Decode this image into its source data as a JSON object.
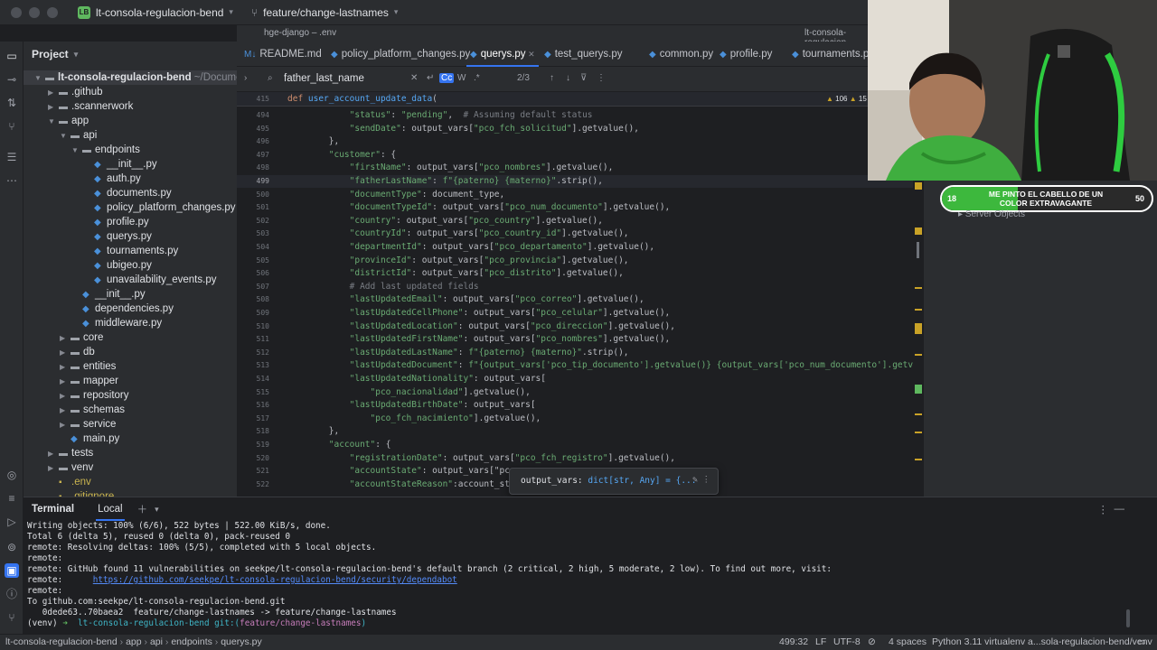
{
  "titlebar": {
    "project_initials": "LB",
    "project_name": "lt-consola-regulacion-bend",
    "branch": "feature/change-lastnames"
  },
  "top_tabs": {
    "left": "hge-django – .env",
    "right": "lt-consola-regulacion"
  },
  "project_panel": {
    "title": "Project",
    "root": "lt-consola-regulacion-bend",
    "root_path": "~/Documents/proje",
    "items": [
      {
        "label": ".github",
        "type": "folder",
        "depth": 1,
        "expanded": false
      },
      {
        "label": ".scannerwork",
        "type": "folder",
        "depth": 1,
        "expanded": false
      },
      {
        "label": "app",
        "type": "folder",
        "depth": 1,
        "expanded": true
      },
      {
        "label": "api",
        "type": "folder",
        "depth": 2,
        "expanded": true
      },
      {
        "label": "endpoints",
        "type": "folder",
        "depth": 3,
        "expanded": true
      },
      {
        "label": "__init__.py",
        "type": "py",
        "depth": 4
      },
      {
        "label": "auth.py",
        "type": "py",
        "depth": 4
      },
      {
        "label": "documents.py",
        "type": "py",
        "depth": 4
      },
      {
        "label": "policy_platform_changes.py",
        "type": "py",
        "depth": 4
      },
      {
        "label": "profile.py",
        "type": "py",
        "depth": 4
      },
      {
        "label": "querys.py",
        "type": "py",
        "depth": 4
      },
      {
        "label": "tournaments.py",
        "type": "py",
        "depth": 4
      },
      {
        "label": "ubigeo.py",
        "type": "py",
        "depth": 4
      },
      {
        "label": "unavailability_events.py",
        "type": "py",
        "depth": 4
      },
      {
        "label": "__init__.py",
        "type": "py",
        "depth": 3
      },
      {
        "label": "dependencies.py",
        "type": "py",
        "depth": 3
      },
      {
        "label": "middleware.py",
        "type": "py",
        "depth": 3
      },
      {
        "label": "core",
        "type": "folder",
        "depth": 2,
        "expanded": false
      },
      {
        "label": "db",
        "type": "folder",
        "depth": 2,
        "expanded": false
      },
      {
        "label": "entities",
        "type": "folder",
        "depth": 2,
        "expanded": false
      },
      {
        "label": "mapper",
        "type": "folder",
        "depth": 2,
        "expanded": false
      },
      {
        "label": "repository",
        "type": "folder",
        "depth": 2,
        "expanded": false
      },
      {
        "label": "schemas",
        "type": "folder",
        "depth": 2,
        "expanded": false
      },
      {
        "label": "service",
        "type": "folder",
        "depth": 2,
        "expanded": false
      },
      {
        "label": "main.py",
        "type": "py",
        "depth": 2
      },
      {
        "label": "tests",
        "type": "folder",
        "depth": 1,
        "expanded": false
      },
      {
        "label": "venv",
        "type": "folder",
        "depth": 1,
        "expanded": false
      },
      {
        "label": ".env",
        "type": "env",
        "depth": 1
      },
      {
        "label": ".gitignore",
        "type": "env",
        "depth": 1
      }
    ]
  },
  "editor_tabs": [
    {
      "label": "README.md",
      "prefix": "M↓",
      "active": false
    },
    {
      "label": "policy_platform_changes.py",
      "active": false
    },
    {
      "label": "querys.py",
      "active": true
    },
    {
      "label": "test_querys.py",
      "active": false
    },
    {
      "label": "common.py",
      "active": false
    },
    {
      "label": "profile.py",
      "active": false
    },
    {
      "label": "tournaments.py",
      "active": false
    }
  ],
  "search": {
    "value": "father_last_name",
    "match_case": "Cc",
    "words": "W",
    "regex": ".*",
    "result": "2/3"
  },
  "editor": {
    "sticky_line": "415",
    "sticky_text": "def user_account_update_data(",
    "warnings": "106",
    "weak_warnings": "15",
    "current_line": "499",
    "lines": [
      {
        "n": "494",
        "code": "            \"status\": \"pending\",  # Assuming default status"
      },
      {
        "n": "495",
        "code": "            \"sendDate\": output_vars[\"pco_fch_solicitud\"].getvalue(),"
      },
      {
        "n": "496",
        "code": "        },"
      },
      {
        "n": "497",
        "code": "        \"customer\": {"
      },
      {
        "n": "498",
        "code": "            \"firstName\": output_vars[\"pco_nombres\"].getvalue(),"
      },
      {
        "n": "499",
        "code": "            \"fatherLastName\": f\"{paterno} {materno}\".strip(),"
      },
      {
        "n": "500",
        "code": "            \"documentType\": document_type,"
      },
      {
        "n": "501",
        "code": "            \"documentTypeId\": output_vars[\"pco_num_documento\"].getvalue(),"
      },
      {
        "n": "502",
        "code": "            \"country\": output_vars[\"pco_country\"].getvalue(),"
      },
      {
        "n": "503",
        "code": "            \"countryId\": output_vars[\"pco_country_id\"].getvalue(),"
      },
      {
        "n": "504",
        "code": "            \"departmentId\": output_vars[\"pco_departamento\"].getvalue(),"
      },
      {
        "n": "505",
        "code": "            \"provinceId\": output_vars[\"pco_provincia\"].getvalue(),"
      },
      {
        "n": "506",
        "code": "            \"districtId\": output_vars[\"pco_distrito\"].getvalue(),"
      },
      {
        "n": "507",
        "code": "            # Add last updated fields"
      },
      {
        "n": "508",
        "code": "            \"lastUpdatedEmail\": output_vars[\"pco_correo\"].getvalue(),"
      },
      {
        "n": "509",
        "code": "            \"lastUpdatedCellPhone\": output_vars[\"pco_celular\"].getvalue(),"
      },
      {
        "n": "510",
        "code": "            \"lastUpdatedLocation\": output_vars[\"pco_direccion\"].getvalue(),"
      },
      {
        "n": "511",
        "code": "            \"lastUpdatedFirstName\": output_vars[\"pco_nombres\"].getvalue(),"
      },
      {
        "n": "512",
        "code": "            \"lastUpdatedLastName\": f\"{paterno} {materno}\".strip(),"
      },
      {
        "n": "513",
        "code": "            \"lastUpdatedDocument\": f\"{output_vars['pco_tip_documento'].getvalue()} {output_vars['pco_num_documento'].getvalue()}\","
      },
      {
        "n": "514",
        "code": "            \"lastUpdatedNationality\": output_vars["
      },
      {
        "n": "515",
        "code": "                \"pco_nacionalidad\"].getvalue(),"
      },
      {
        "n": "516",
        "code": "            \"lastUpdatedBirthDate\": output_vars["
      },
      {
        "n": "517",
        "code": "                \"pco_fch_nacimiento\"].getvalue(),"
      },
      {
        "n": "518",
        "code": "        },"
      },
      {
        "n": "519",
        "code": "        \"account\": {"
      },
      {
        "n": "520",
        "code": "            \"registrationDate\": output_vars[\"pco_fch_registro\"].getvalue(),"
      },
      {
        "n": "521",
        "code": "            \"accountState\": output_vars[\"pc"
      },
      {
        "n": "522",
        "code": "            \"accountStateReason\":account_st"
      }
    ]
  },
  "tooltip": {
    "name": "output_vars",
    "type": "dict[str, Any] = {...",
    "edit_icon": "✎",
    "more_icon": "⋮"
  },
  "overlay": {
    "goal_text": "ME PINTO EL CABELLO DE UN COLOR EXTRAVAGANTE",
    "goal_current": "18",
    "goal_target": "50",
    "goal_fraction": 0.36,
    "server_objects": "Server Objects"
  },
  "terminal": {
    "title": "Terminal",
    "tab": "Local",
    "lines": [
      "Writing objects: 100% (6/6), 522 bytes | 522.00 KiB/s, done.",
      "Total 6 (delta 5), reused 0 (delta 0), pack-reused 0",
      "remote: Resolving deltas: 100% (5/5), completed with 5 local objects.",
      "remote:",
      "remote: GitHub found 11 vulnerabilities on seekpe/lt-consola-regulacion-bend's default branch (2 critical, 2 high, 5 moderate, 2 low). To find out more, visit:"
    ],
    "link_prefix": "remote:      ",
    "link": "https://github.com/seekpe/lt-consola-regulacion-bend/security/dependabot",
    "lines2": [
      "remote:",
      "To github.com:seekpe/lt-consola-regulacion-bend.git",
      "   0dede63..70baea2  feature/change-lastnames -> feature/change-lastnames"
    ],
    "prompt_venv": "(venv)",
    "prompt_arrow": "➜",
    "prompt_dir": "lt-consola-regulacion-bend",
    "prompt_git": "git:(",
    "prompt_branch": "feature/change-lastnames",
    "prompt_close": ")"
  },
  "statusbar": {
    "breadcrumb": [
      "lt-consola-regulacion-bend",
      "app",
      "api",
      "endpoints",
      "querys.py"
    ],
    "position": "499:32",
    "line_sep": "LF",
    "encoding": "UTF-8",
    "indent": "4 spaces",
    "interpreter": "Python 3.11 virtualenv a...sola-regulacion-bend/venv"
  }
}
